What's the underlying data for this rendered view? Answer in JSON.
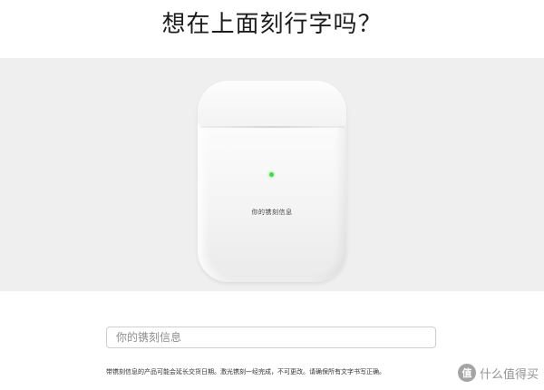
{
  "page": {
    "title": "想在上面刻行字吗？"
  },
  "preview": {
    "engraving_text": "你的镌刻信息",
    "status_light_color": "#3ddc4a",
    "band_color": "#efefef"
  },
  "engraving_input": {
    "placeholder": "你的镌刻信息",
    "value": ""
  },
  "disclaimer": {
    "text": "带镌刻信息的产品可能会延长交货日期。激光镌刻一经完成，不可更改。请确保所有文字书写正确。"
  },
  "watermark": {
    "badge": "值",
    "text": "什么值得买"
  }
}
